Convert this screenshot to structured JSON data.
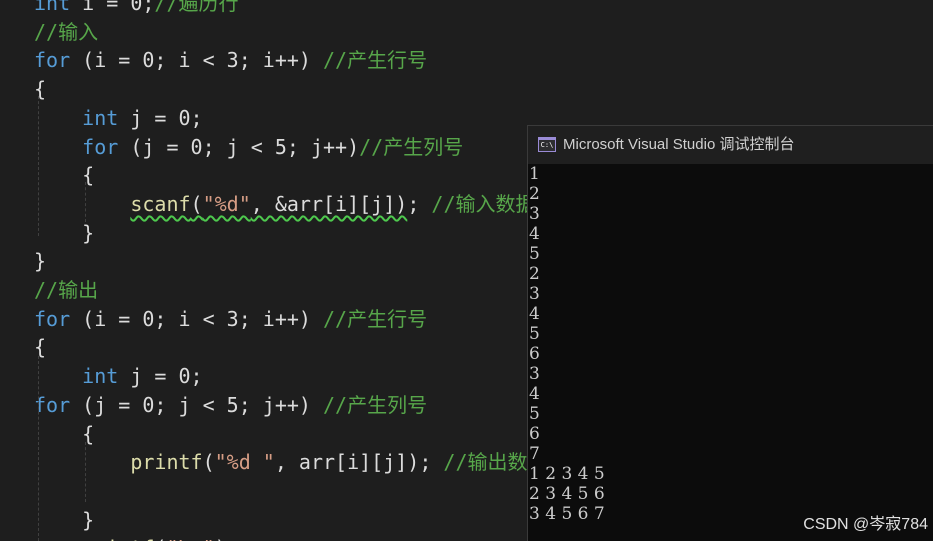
{
  "editor": {
    "lines": [
      [
        {
          "t": "int",
          "c": "kw"
        },
        {
          "t": " i = 0;",
          "c": "txt"
        },
        {
          "t": "//遍历行",
          "c": "cmt"
        }
      ],
      [
        {
          "t": "//输入",
          "c": "cmt"
        }
      ],
      [
        {
          "t": "for",
          "c": "kw"
        },
        {
          "t": " (i = 0; i < 3; i++) ",
          "c": "txt"
        },
        {
          "t": "//产生行号",
          "c": "cmt"
        }
      ],
      [
        {
          "t": "{",
          "c": "txt"
        }
      ],
      [
        {
          "t": "    ",
          "c": "txt"
        },
        {
          "t": "int",
          "c": "kw"
        },
        {
          "t": " j = 0;",
          "c": "txt"
        }
      ],
      [
        {
          "t": "    ",
          "c": "txt"
        },
        {
          "t": "for",
          "c": "kw"
        },
        {
          "t": " (j = 0; j < 5; j++)",
          "c": "txt"
        },
        {
          "t": "//产生列号",
          "c": "cmt"
        }
      ],
      [
        {
          "t": "    {",
          "c": "txt"
        }
      ],
      [
        {
          "t": "        ",
          "c": "txt"
        },
        {
          "t": "scanf",
          "c": "fn",
          "s": true
        },
        {
          "t": "(",
          "c": "txt",
          "s": true
        },
        {
          "t": "\"%d\"",
          "c": "str",
          "s": true
        },
        {
          "t": ", &arr[i][j])",
          "c": "txt",
          "s": true
        },
        {
          "t": "; ",
          "c": "txt"
        },
        {
          "t": "//输入数据",
          "c": "cmt"
        }
      ],
      [
        {
          "t": "    }",
          "c": "txt"
        }
      ],
      [
        {
          "t": "}",
          "c": "txt"
        }
      ],
      [
        {
          "t": "//输出",
          "c": "cmt"
        }
      ],
      [
        {
          "t": "for",
          "c": "kw"
        },
        {
          "t": " (i = 0; i < 3; i++) ",
          "c": "txt"
        },
        {
          "t": "//产生行号",
          "c": "cmt"
        }
      ],
      [
        {
          "t": "{",
          "c": "txt"
        }
      ],
      [
        {
          "t": "    ",
          "c": "txt"
        },
        {
          "t": "int",
          "c": "kw"
        },
        {
          "t": " j = 0;",
          "c": "txt"
        }
      ],
      [
        {
          "t": "for",
          "c": "kw"
        },
        {
          "t": " (j = 0; j < 5; j++) ",
          "c": "txt"
        },
        {
          "t": "//产生列号",
          "c": "cmt"
        }
      ],
      [
        {
          "t": "    {",
          "c": "txt"
        }
      ],
      [
        {
          "t": "        ",
          "c": "txt"
        },
        {
          "t": "printf",
          "c": "fn"
        },
        {
          "t": "(",
          "c": "txt"
        },
        {
          "t": "\"%d \"",
          "c": "str"
        },
        {
          "t": ", arr[i][j]); ",
          "c": "txt"
        },
        {
          "t": "//输出数据",
          "c": "cmt"
        }
      ],
      [
        {
          "t": "",
          "c": "txt"
        }
      ],
      [
        {
          "t": "    }",
          "c": "txt"
        }
      ],
      [
        {
          "t": "    ",
          "c": "txt"
        },
        {
          "t": "printf",
          "c": "fn"
        },
        {
          "t": "(",
          "c": "txt"
        },
        {
          "t": "\"\\n\"",
          "c": "str"
        },
        {
          "t": ");",
          "c": "txt"
        }
      ]
    ]
  },
  "console": {
    "title": "Microsoft Visual Studio 调试控制台",
    "icon_label": "C:\\",
    "output_lines": [
      "1",
      "2",
      "3",
      "4",
      "5",
      "2",
      "3",
      "4",
      "5",
      "6",
      "3",
      "4",
      "5",
      "6",
      "7",
      "1 2 3 4 5",
      "2 3 4 5 6",
      "3 4 5 6 7"
    ]
  },
  "watermark": "CSDN @岑寂784",
  "colors": {
    "background": "#1e1e1e",
    "keyword": "#569cd6",
    "function": "#dcdcaa",
    "string": "#d69d85",
    "comment": "#57a64a",
    "text": "#dcdcdc",
    "console_bg": "#0c0c0c"
  }
}
